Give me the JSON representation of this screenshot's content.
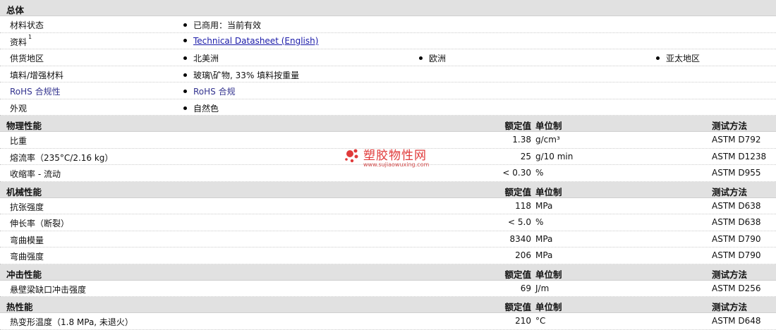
{
  "sections": {
    "general": {
      "title": "总体",
      "rows": [
        {
          "label": "材料状态",
          "values": [
            "已商用：当前有效"
          ]
        },
        {
          "label": "资料",
          "sup": "1",
          "link": "Technical Datasheet (English)"
        },
        {
          "label": "供货地区",
          "values": [
            "北美洲",
            "欧洲",
            "亚太地区"
          ]
        },
        {
          "label": "填料/增强材料",
          "values": [
            "玻璃\\矿物, 33% 填料按重量"
          ]
        },
        {
          "label": "RoHS 合规性",
          "values": [
            "RoHS 合规"
          ]
        },
        {
          "label": "外观",
          "values": [
            "自然色"
          ]
        }
      ]
    },
    "physical": {
      "title": "物理性能",
      "col_value": "额定值",
      "col_unit": "单位制",
      "col_method": "测试方法",
      "rows": [
        {
          "label": "比重",
          "value": "1.38",
          "unit": "g/cm³",
          "method": "ASTM D792"
        },
        {
          "label": "熔流率（235°C/2.16 kg）",
          "value": "25",
          "unit": "g/10 min",
          "method": "ASTM D1238"
        },
        {
          "label": "收缩率 - 流动",
          "value": "< 0.30",
          "unit": "%",
          "method": "ASTM D955"
        }
      ]
    },
    "mechanical": {
      "title": "机械性能",
      "col_value": "额定值",
      "col_unit": "单位制",
      "col_method": "测试方法",
      "rows": [
        {
          "label": "抗张强度",
          "value": "118",
          "unit": "MPa",
          "method": "ASTM D638"
        },
        {
          "label": "伸长率（断裂）",
          "value": "< 5.0",
          "unit": "%",
          "method": "ASTM D638"
        },
        {
          "label": "弯曲模量",
          "value": "8340",
          "unit": "MPa",
          "method": "ASTM D790"
        },
        {
          "label": "弯曲强度",
          "value": "206",
          "unit": "MPa",
          "method": "ASTM D790"
        }
      ]
    },
    "impact": {
      "title": "冲击性能",
      "col_value": "额定值",
      "col_unit": "单位制",
      "col_method": "测试方法",
      "rows": [
        {
          "label": "悬壁梁缺口冲击强度",
          "value": "69",
          "unit": "J/m",
          "method": "ASTM D256"
        }
      ]
    },
    "thermal": {
      "title": "热性能",
      "col_value": "额定值",
      "col_unit": "单位制",
      "col_method": "测试方法",
      "rows": [
        {
          "label": "热变形温度（1.8 MPa, 未退火）",
          "value": "210",
          "unit": "°C",
          "method": "ASTM D648"
        }
      ]
    }
  },
  "watermark": {
    "text": "塑胶物性网",
    "url": "www.sujiaowuxing.com"
  },
  "colors": {
    "header_bg": "#e1e1e1",
    "link": "#1a1aa8",
    "rohs_label": "#33338f",
    "watermark": "#e03a3a"
  }
}
